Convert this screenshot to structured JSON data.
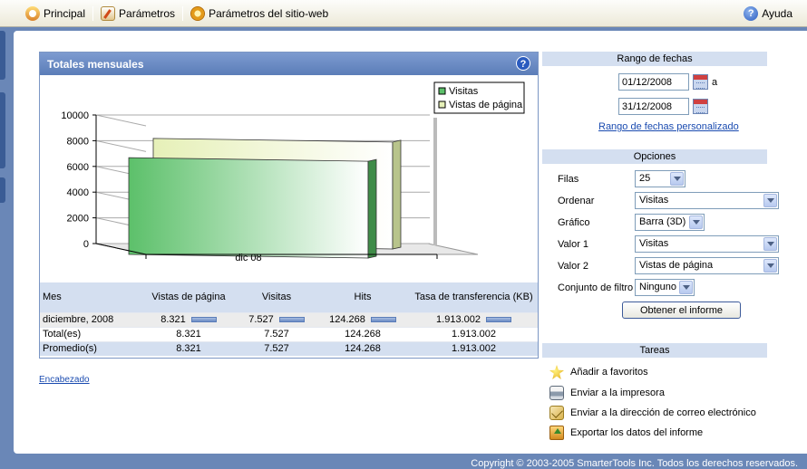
{
  "toolbar": {
    "home_label": "Principal",
    "params_label": "Parámetros",
    "site_params_label": "Parámetros del sitio-web",
    "help_label": "Ayuda"
  },
  "chart_panel": {
    "title": "Totales mensuales",
    "help_glyph": "?"
  },
  "chart_data": {
    "type": "bar",
    "categories": [
      "dic 08"
    ],
    "series": [
      {
        "name": "Visitas",
        "values": [
          7527
        ],
        "color": "#5cc06a"
      },
      {
        "name": "Vistas de página",
        "values": [
          8321
        ],
        "color": "#e6f0b8"
      }
    ],
    "ylim": [
      0,
      10000
    ],
    "yticks": [
      "0",
      "2000",
      "4000",
      "6000",
      "8000",
      "10000"
    ],
    "legend": "top-right",
    "grid": true
  },
  "table": {
    "headers": [
      "Mes",
      "Vistas de página",
      "Visitas",
      "Hits",
      "Tasa de transferencia (KB)"
    ],
    "rows": [
      {
        "label": "diciembre, 2008",
        "values": [
          "8.321",
          "7.527",
          "124.268",
          "1.913.002"
        ],
        "bars": true
      },
      {
        "label": "Total(es)",
        "values": [
          "8.321",
          "7.527",
          "124.268",
          "1.913.002"
        ],
        "bars": false
      },
      {
        "label": "Promedio(s)",
        "values": [
          "8.321",
          "7.527",
          "124.268",
          "1.913.002"
        ],
        "bars": false
      }
    ]
  },
  "encabezado_link": "Encabezado",
  "date_range": {
    "title": "Rango de fechas",
    "start": "01/12/2008",
    "separator": "a",
    "end": "31/12/2008",
    "custom_link": "Rango de fechas personalizado"
  },
  "options": {
    "title": "Opciones",
    "rows_label": "Filas",
    "rows_value": "25",
    "sort_label": "Ordenar",
    "sort_value": "Visitas",
    "chart_label": "Gráfico",
    "chart_value": "Barra (3D)",
    "value1_label": "Valor 1",
    "value1_value": "Visitas",
    "value2_label": "Valor 2",
    "value2_value": "Vistas de página",
    "filter_label": "Conjunto de filtro",
    "filter_value": "Ninguno",
    "submit_label": "Obtener el informe"
  },
  "tasks": {
    "title": "Tareas",
    "items": [
      {
        "label": "Añadir a favoritos",
        "icon": "star-icon"
      },
      {
        "label": "Enviar a la impresora",
        "icon": "printer-icon"
      },
      {
        "label": "Enviar a la dirección de correo electrónico",
        "icon": "mail-icon"
      },
      {
        "label": "Exportar los datos del informe",
        "icon": "export-icon"
      }
    ]
  },
  "footer": "Copyright © 2003-2005 SmarterTools Inc. Todos los derechos reservados."
}
